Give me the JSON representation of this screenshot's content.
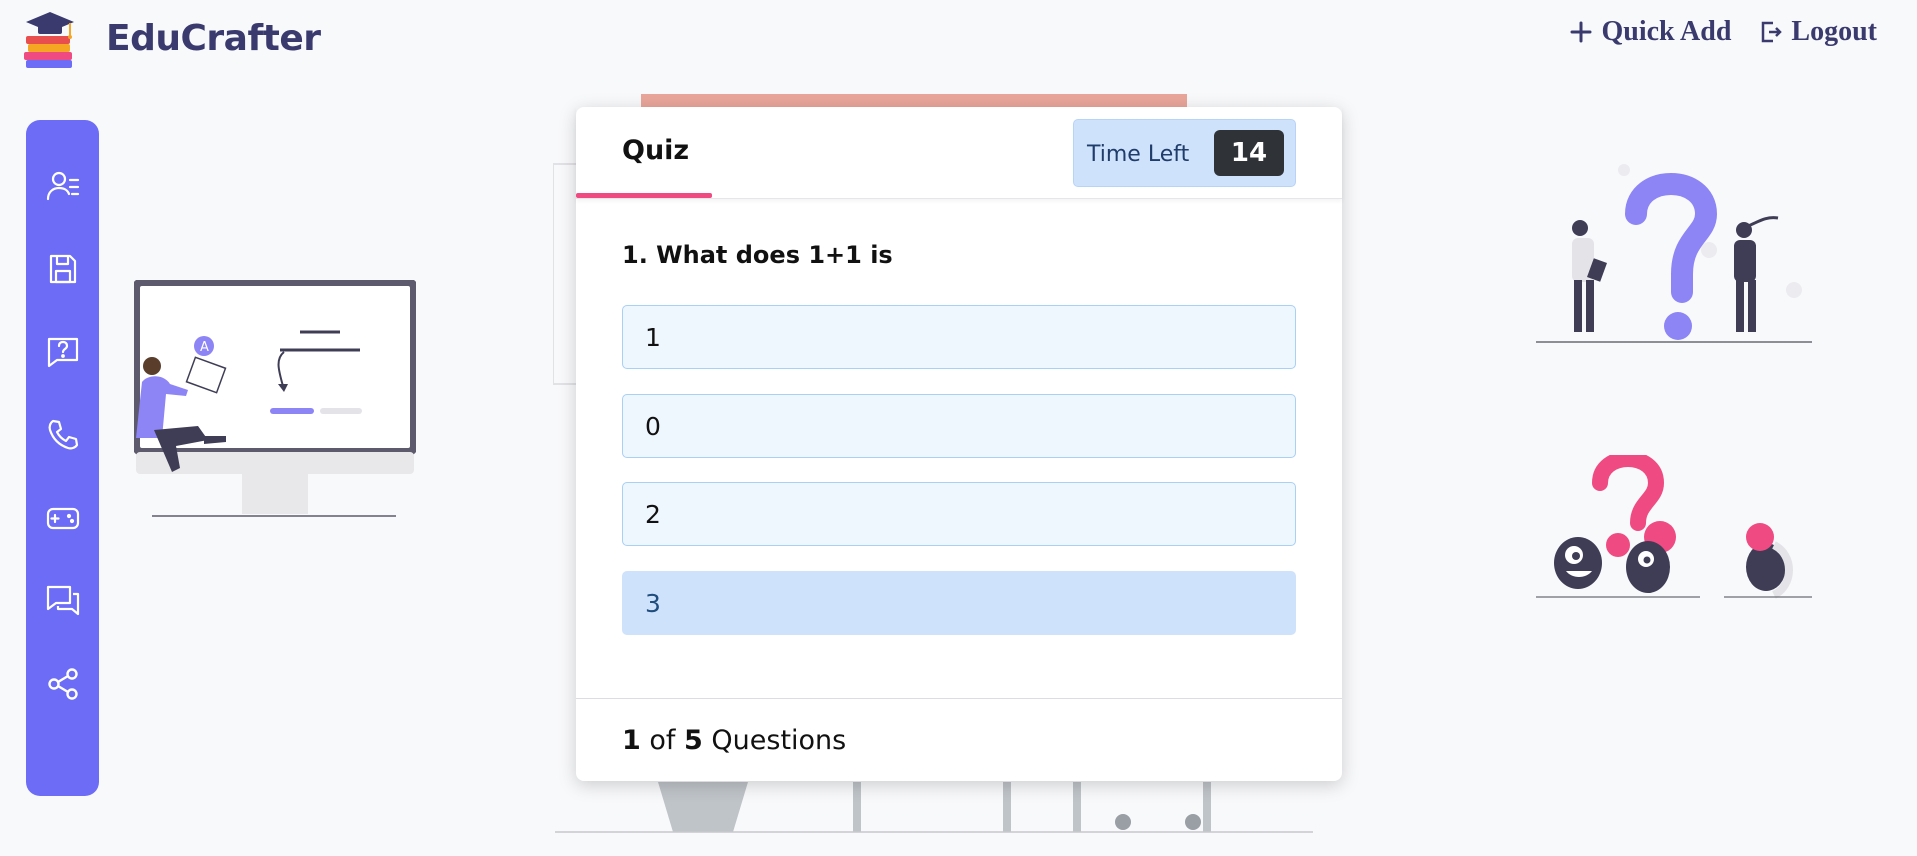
{
  "brand": {
    "name": "EduCrafter"
  },
  "header": {
    "quick_add": "Quick Add",
    "logout": "Logout"
  },
  "sidebar": {
    "items": [
      {
        "name": "user-list",
        "icon": "user-list-icon"
      },
      {
        "name": "save",
        "icon": "floppy-disk-icon"
      },
      {
        "name": "quiz",
        "icon": "question-chat-icon"
      },
      {
        "name": "contact",
        "icon": "phone-icon"
      },
      {
        "name": "games",
        "icon": "gamepad-icon"
      },
      {
        "name": "chat",
        "icon": "chat-bubbles-icon"
      },
      {
        "name": "share",
        "icon": "share-icon"
      }
    ],
    "color": "#6c6cf7"
  },
  "quiz": {
    "title": "Quiz",
    "timer_label": "Time Left",
    "timer_value": "14",
    "question": "1. What does 1+1 is",
    "options": [
      "1",
      "0",
      "2",
      "3"
    ],
    "selected_index": 3,
    "progress_current": "1",
    "progress_of": "of",
    "progress_total": "5",
    "progress_suffix": "Questions"
  },
  "colors": {
    "accent": "#ef4a82",
    "primary": "#6c6cf7",
    "brand_text": "#3a3a6e"
  }
}
